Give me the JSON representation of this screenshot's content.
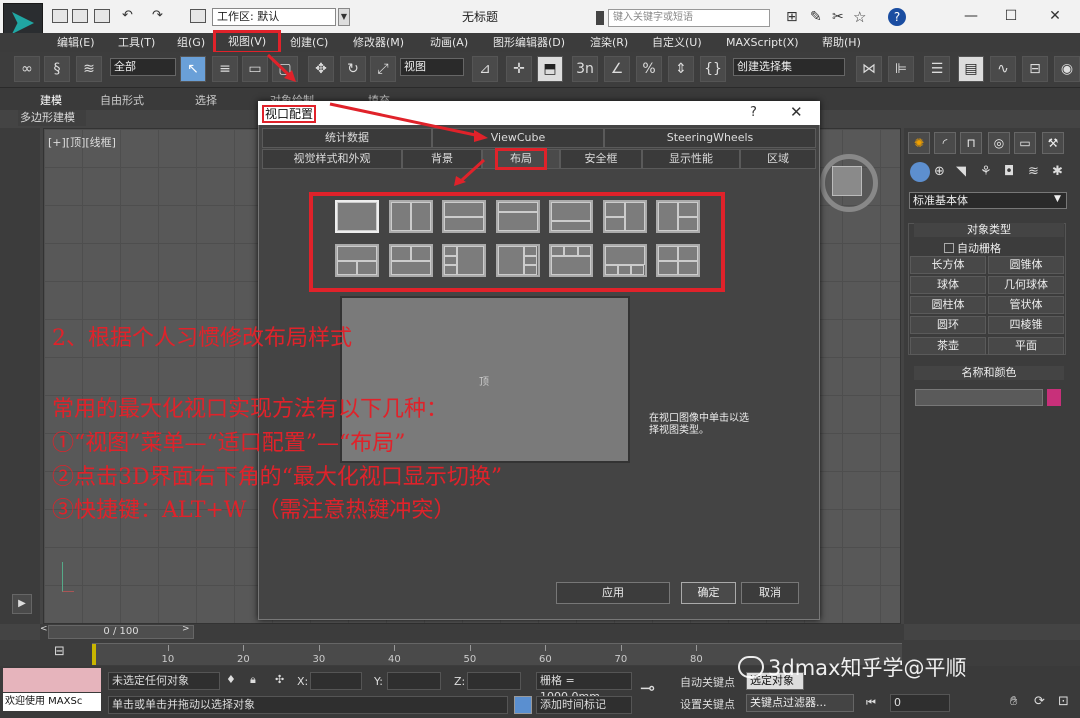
{
  "titlebar": {
    "workspace": "工作区: 默认",
    "window_title": "无标题",
    "search_placeholder": "键入关键字或短语",
    "minimize": "—",
    "maximize": "☐",
    "close": "✕"
  },
  "menubar": {
    "items": [
      "编辑(E)",
      "工具(T)",
      "组(G)",
      "视图(V)",
      "创建(C)",
      "修改器(M)",
      "动画(A)",
      "图形编辑器(D)",
      "渲染(R)",
      "自定义(U)",
      "MAXScript(X)",
      "帮助(H)"
    ]
  },
  "toolbar": {
    "filter": "全部",
    "coord": "视图",
    "selection_set": "创建选择集",
    "snap_label": "3n"
  },
  "ribbon": {
    "tabs": [
      "建模",
      "自由形式",
      "选择",
      "对象绘制",
      "填充"
    ],
    "sub": "多边形建模"
  },
  "viewport": {
    "label": "[+][顶][线框]"
  },
  "command_panel": {
    "dropdown": "标准基本体",
    "object_type_header": "对象类型",
    "autogrid": "自动栅格",
    "buttons": [
      "长方体",
      "圆锥体",
      "球体",
      "几何球体",
      "圆柱体",
      "管状体",
      "圆环",
      "四棱锥",
      "茶壶",
      "平面"
    ],
    "name_color_header": "名称和颜色"
  },
  "dialog": {
    "title": "视口配置",
    "help": "?",
    "close": "✕",
    "tabs_row1": [
      "统计数据",
      "ViewCube",
      "SteeringWheels"
    ],
    "tabs_row2": [
      "视觉样式和外观",
      "背景",
      "布局",
      "安全框",
      "显示性能",
      "区域"
    ],
    "preview_label": "顶",
    "hint": "在视口图像中单击以选择视图类型。",
    "buttons": {
      "apply": "应用",
      "ok": "确定",
      "cancel": "取消"
    }
  },
  "annotation": {
    "line1": "2、根据个人习惯修改布局样式",
    "line2": "常用的最大化视口实现方法有以下几种：",
    "line3": "①“视图”菜单—“适口配置”—“布局”",
    "line4": "②点击3D界面右下角的“最大化视口显示切换”",
    "line5": "③快捷键：ALT+W　（需注意热键冲突）"
  },
  "timeline": {
    "frame": "0 / 100",
    "ticks": [
      "10",
      "20",
      "30",
      "40",
      "50",
      "60",
      "70",
      "80"
    ]
  },
  "status": {
    "welcome": "欢迎使用 MAXSc",
    "selection": "未选定任何对象",
    "prompt": "单击或单击并拖动以选择对象",
    "x_label": "X:",
    "y_label": "Y:",
    "z_label": "Z:",
    "grid": "栅格 = 1000.0mm",
    "add_time_tag": "添加时间标记",
    "auto_key": "自动关键点",
    "set_key": "设置关键点",
    "selected": "选定对象",
    "key_filters": "关键点过滤器...",
    "frame_field": "0"
  },
  "watermark": "3dmax知乎学@平顺"
}
